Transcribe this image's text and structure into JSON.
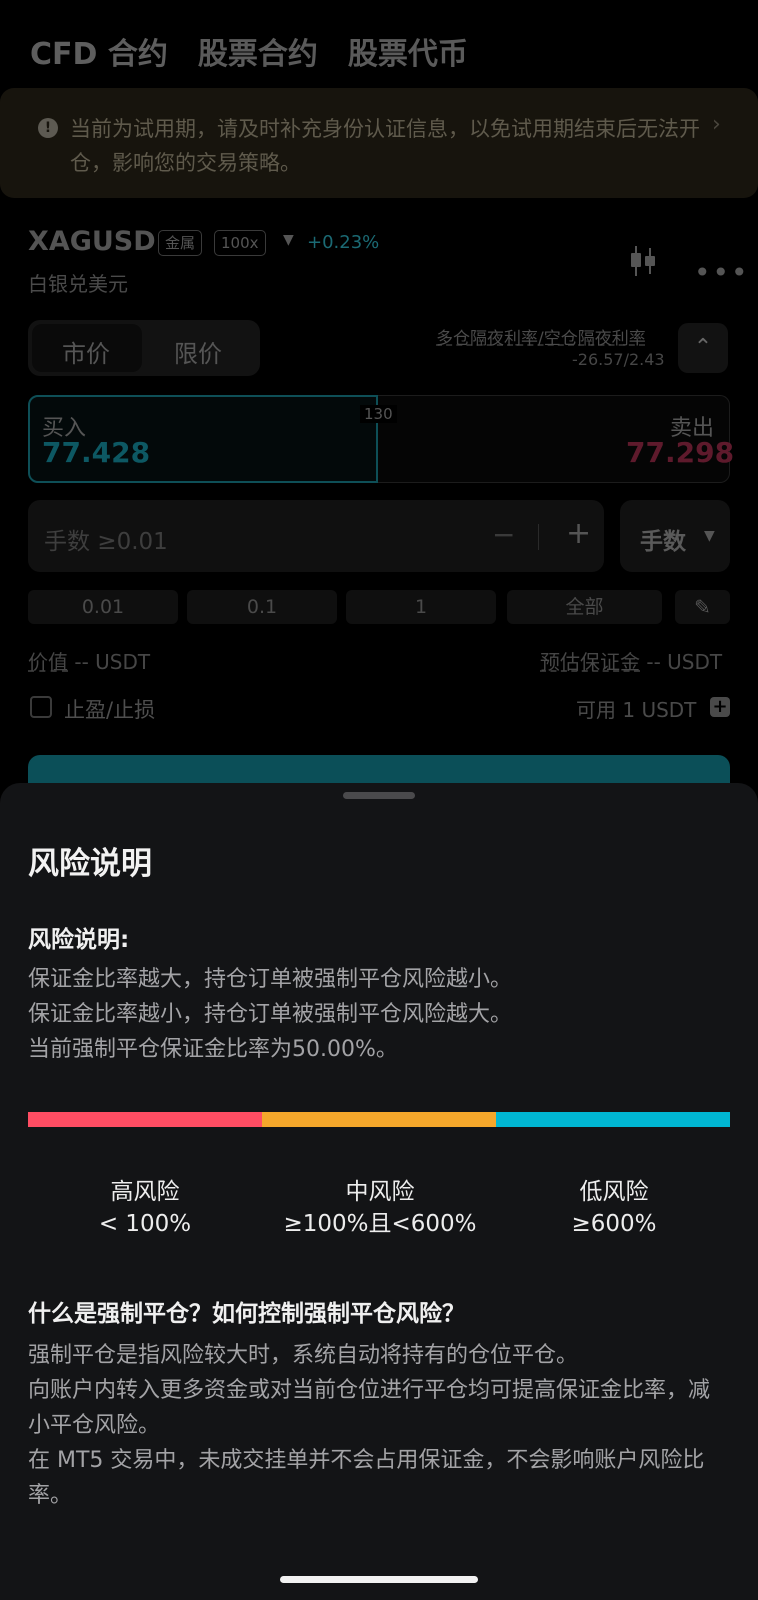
{
  "tabs": [
    "CFD 合约",
    "股票合约",
    "股票代币"
  ],
  "notice": {
    "text": "当前为试用期，请及时补充身份认证信息，以免试用期结束后无法开仓，影响您的交易策略。"
  },
  "symbol": {
    "code": "XAGUSD",
    "tag_category": "金属",
    "tag_leverage": "100x",
    "change": "+0.23%",
    "name": "白银兑美元"
  },
  "order_type": {
    "market": "市价",
    "limit": "限价"
  },
  "overnight": {
    "title": "多仓隔夜利率/空仓隔夜利率",
    "values": "-26.57/2.43"
  },
  "quote": {
    "buy_label": "买入",
    "buy_price": "77.428",
    "spread": "130",
    "sell_label": "卖出",
    "sell_price": "77.298"
  },
  "quantity": {
    "placeholder": "手数 ≥0.01",
    "minus": "−",
    "plus": "+",
    "unit": "手数"
  },
  "quick_amounts": [
    "0.01",
    "0.1",
    "1",
    "全部"
  ],
  "value": {
    "label": "价值",
    "amount": "-- USDT"
  },
  "margin": {
    "label": "预估保证金",
    "amount": "-- USDT"
  },
  "tpsl_label": "止盈/止损",
  "available": "可用  1 USDT",
  "colors": {
    "accent": "#0b4f58",
    "high_risk": "#ff4d63",
    "mid_risk": "#f5a72b",
    "low_risk": "#00b7d3"
  },
  "sheet": {
    "title": "风险说明",
    "section1_title": "风险说明:",
    "section1_lines": [
      "保证金比率越大，持仓订单被强制平仓风险越小。",
      "保证金比率越小，持仓订单被强制平仓风险越大。",
      "当前强制平仓保证金比率为50.00%。"
    ],
    "levels": [
      {
        "name": "高风险",
        "range": "< 100%"
      },
      {
        "name": "中风险",
        "range": "≥100%且<600%"
      },
      {
        "name": "低风险",
        "range": "≥600%"
      }
    ],
    "section2_title": "什么是强制平仓？如何控制强制平仓风险？",
    "section2_lines": [
      "强制平仓是指风险较大时，系统自动将持有的仓位平仓。",
      "向账户内转入更多资金或对当前仓位进行平仓均可提高保证金比率，减小平仓风险。",
      "在 MT5 交易中，未成交挂单并不会占用保证金，不会影响账户风险比率。"
    ]
  }
}
